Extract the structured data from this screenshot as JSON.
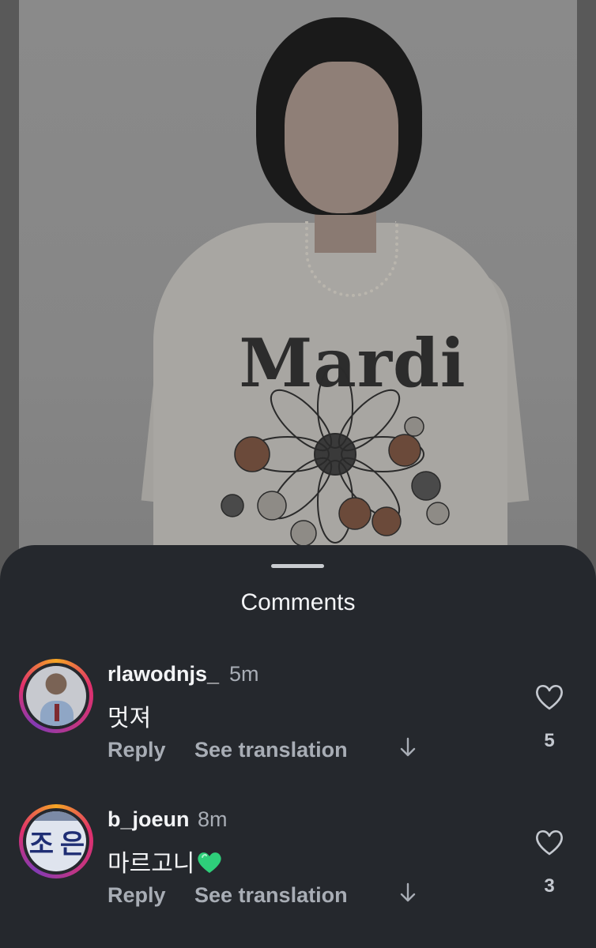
{
  "post": {
    "shirt_print": "Mardi"
  },
  "sheet": {
    "title": "Comments"
  },
  "comments": [
    {
      "username": "rlawodnjs_",
      "time": "5m",
      "text": "멋져",
      "reply_label": "Reply",
      "translate_label": "See translation",
      "likes": "5"
    },
    {
      "username": "b_joeun",
      "time": "8m",
      "text": "마르고니",
      "emoji": "green-heart",
      "avatar_text": "조 은",
      "reply_label": "Reply",
      "translate_label": "See translation",
      "likes": "3"
    }
  ],
  "colors": {
    "sheet_bg": "#25282d",
    "text_primary": "#f3f4f6",
    "text_secondary": "#a8adb5",
    "story_ring": [
      "#f5a623",
      "#e1306c",
      "#833ab4"
    ],
    "green_heart": "#2ecf7a"
  },
  "icons": {
    "like": "heart-outline-icon",
    "expand": "down-arrow-icon"
  }
}
